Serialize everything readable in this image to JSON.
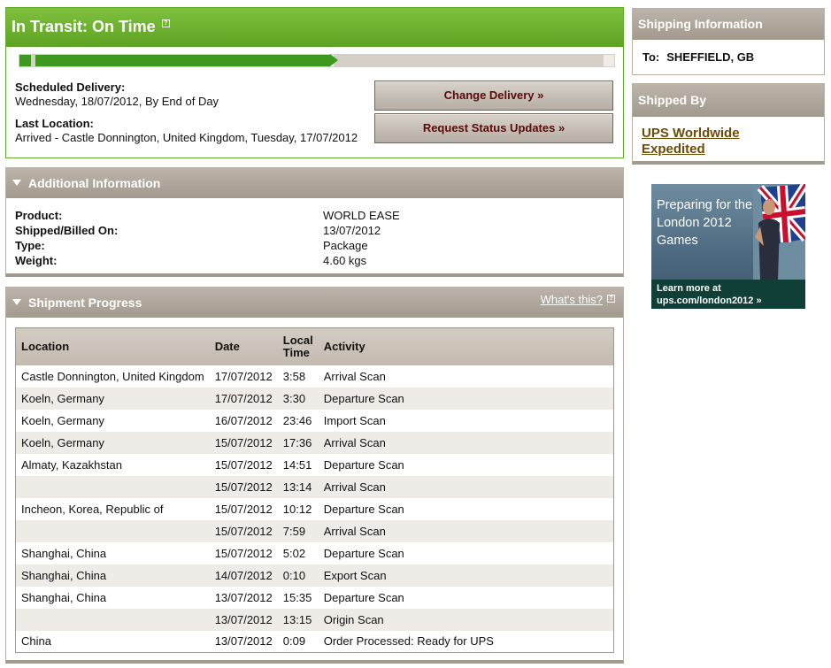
{
  "status": {
    "title": "In Transit: On Time",
    "progress_fraction": 0.5,
    "scheduled_label": "Scheduled Delivery:",
    "scheduled_value": "Wednesday, 18/07/2012, By End of Day",
    "last_location_label": "Last Location:",
    "last_location_value": "Arrived - Castle Donnington, United Kingdom, Tuesday, 17/07/2012",
    "change_delivery_button": "Change Delivery »",
    "request_updates_button": "Request Status Updates »"
  },
  "additional_info": {
    "title": "Additional Information",
    "fields": [
      {
        "label": "Product:",
        "value": "WORLD EASE"
      },
      {
        "label": "Shipped/Billed On:",
        "value": "13/07/2012"
      },
      {
        "label": "Type:",
        "value": "Package"
      },
      {
        "label": "Weight:",
        "value": "4.60 kgs"
      }
    ]
  },
  "shipment_progress": {
    "title": "Shipment Progress",
    "whats_this": "What's this?",
    "headers": {
      "location": "Location",
      "date": "Date",
      "time_line1": "Local",
      "time_line2": "Time",
      "activity": "Activity"
    },
    "rows": [
      {
        "location": "Castle Donnington, United Kingdom",
        "date": "17/07/2012",
        "time": "3:58",
        "activity": "Arrival Scan"
      },
      {
        "location": "Koeln, Germany",
        "date": "17/07/2012",
        "time": "3:30",
        "activity": "Departure Scan"
      },
      {
        "location": "Koeln, Germany",
        "date": "16/07/2012",
        "time": "23:46",
        "activity": "Import Scan"
      },
      {
        "location": "Koeln, Germany",
        "date": "15/07/2012",
        "time": "17:36",
        "activity": "Arrival Scan"
      },
      {
        "location": "Almaty, Kazakhstan",
        "date": "15/07/2012",
        "time": "14:51",
        "activity": "Departure Scan"
      },
      {
        "location": "",
        "date": "15/07/2012",
        "time": "13:14",
        "activity": "Arrival Scan"
      },
      {
        "location": "Incheon, Korea, Republic of",
        "date": "15/07/2012",
        "time": "10:12",
        "activity": "Departure Scan"
      },
      {
        "location": "",
        "date": "15/07/2012",
        "time": "7:59",
        "activity": "Arrival Scan"
      },
      {
        "location": "Shanghai, China",
        "date": "15/07/2012",
        "time": "5:02",
        "activity": "Departure Scan"
      },
      {
        "location": "Shanghai, China",
        "date": "14/07/2012",
        "time": "0:10",
        "activity": "Export Scan"
      },
      {
        "location": "Shanghai, China",
        "date": "13/07/2012",
        "time": "15:35",
        "activity": "Departure Scan"
      },
      {
        "location": "",
        "date": "13/07/2012",
        "time": "13:15",
        "activity": "Origin Scan"
      },
      {
        "location": "China",
        "date": "13/07/2012",
        "time": "0:09",
        "activity": "Order Processed: Ready for UPS"
      }
    ]
  },
  "shipping_info": {
    "title": "Shipping Information",
    "to_label": "To:",
    "to_value": "SHEFFIELD, GB"
  },
  "shipped_by": {
    "title": "Shipped By",
    "service": "UPS Worldwide Expedited"
  },
  "ad": {
    "headline": "Preparing for the London 2012 Games",
    "footer_line1": "Learn more at",
    "footer_line2": "ups.com/london2012 »"
  },
  "colors": {
    "status_green": "#5ea223",
    "progress_green": "#3f9920",
    "panel_tan": "#a39a8e",
    "button_text": "#5a0a0a",
    "link_brown": "#6b4c06"
  },
  "icons": {
    "help": "help-box-icon",
    "collapse": "triangle-down-icon"
  }
}
